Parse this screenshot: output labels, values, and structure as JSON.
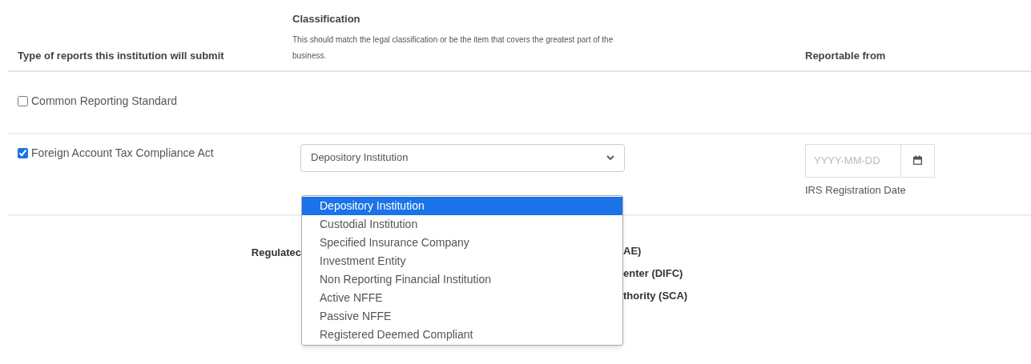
{
  "header": {
    "type_column": "Type of reports this institution will submit",
    "classification": {
      "title": "Classification",
      "hint": "This should match the legal classification or be the item that covers the greatest part of the business."
    },
    "reportable_column": "Reportable from"
  },
  "reports": [
    {
      "label": "Common Reporting Standard",
      "checked": false
    },
    {
      "label": "Foreign Account Tax Compliance Act",
      "checked": true,
      "classification": "Depository Institution",
      "date_placeholder": "YYYY-MM-DD",
      "date_hint": "IRS Registration Date"
    }
  ],
  "dropdown_options": [
    {
      "label": "Depository Institution",
      "selected": true
    },
    {
      "label": "Custodial Institution",
      "selected": false
    },
    {
      "label": "Specified Insurance Company",
      "selected": false
    },
    {
      "label": "Investment Entity",
      "selected": false
    },
    {
      "label": "Non Reporting Financial Institution",
      "selected": false
    },
    {
      "label": "Active NFFE",
      "selected": false
    },
    {
      "label": "Passive NFFE",
      "selected": false
    },
    {
      "label": "Registered Deemed Compliant",
      "selected": false
    }
  ],
  "regulator_label": "Regulatec",
  "regulator_fragments": [
    "AE)",
    "enter (DIFC)",
    "thority (SCA)"
  ]
}
